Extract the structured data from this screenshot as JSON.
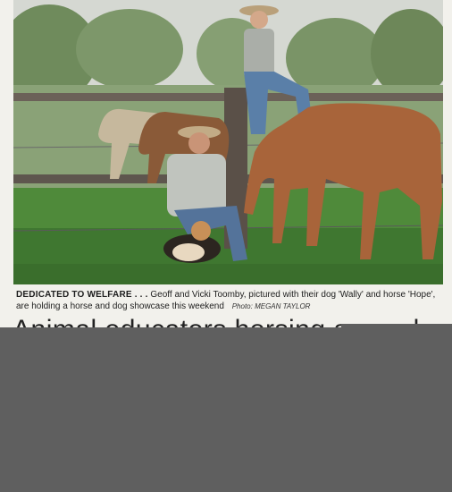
{
  "article": {
    "caption": {
      "lead": "DEDICATED TO WELFARE . . .",
      "text": "Geoff and Vicki Toomby, pictured with their dog 'Wally' and horse 'Hope', are holding a horse and dog showcase this weekend",
      "credit": "Photo: MEGAN TAYLOR"
    },
    "headline": "Animal educators horsing around"
  },
  "colors": {
    "grass": "#4f8a3a",
    "sky": "#d9dcd8",
    "redaction": "#5f5f5f",
    "horse": "#a8643a"
  }
}
